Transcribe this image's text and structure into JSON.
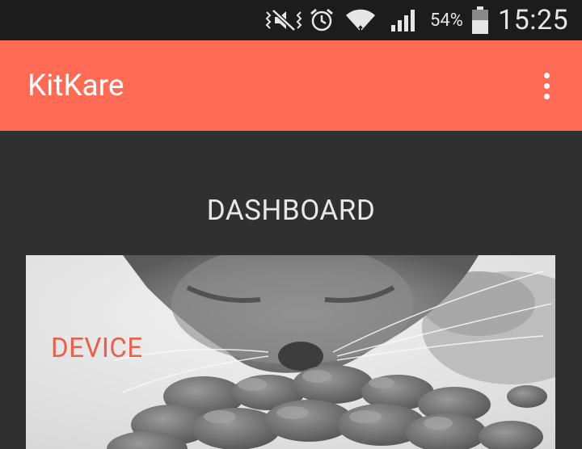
{
  "status_bar": {
    "icons": [
      "vibrate-mute-icon",
      "alarm-icon",
      "wifi-icon",
      "signal-icon",
      "battery-icon"
    ],
    "battery_percent": "54%",
    "time": "15:25"
  },
  "app_bar": {
    "title": "KitKare",
    "menu_icon": "more-vert-icon",
    "color": "#ff6b54"
  },
  "main": {
    "heading": "DASHBOARD",
    "cards": [
      {
        "label": "DEVICE",
        "label_color": "#e8604c",
        "image": "cat-eating-photo"
      }
    ]
  }
}
